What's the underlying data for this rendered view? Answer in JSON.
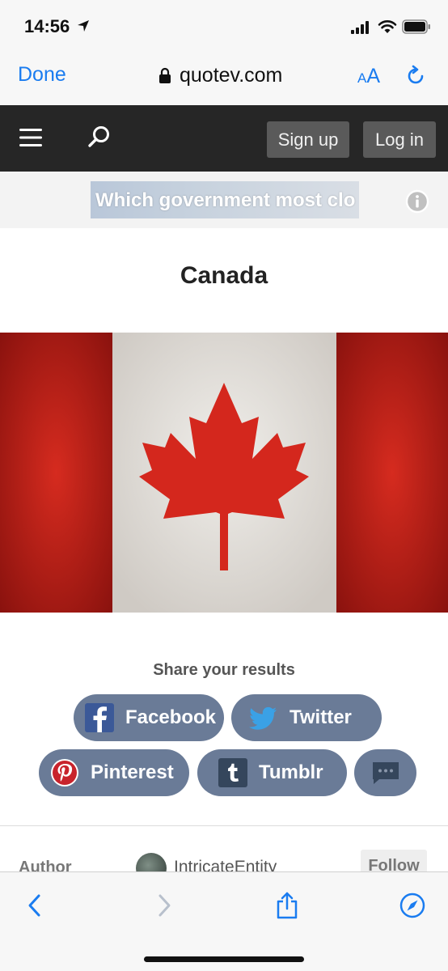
{
  "status_bar": {
    "time": "14:56",
    "icons": [
      "location-arrow-icon",
      "signal-icon",
      "wifi-icon",
      "battery-icon"
    ]
  },
  "safari": {
    "done_label": "Done",
    "url": "quotev.com",
    "aa_small": "A",
    "aa_big": "A",
    "icons": [
      "lock-icon",
      "reload-icon"
    ]
  },
  "site_nav": {
    "signup_label": "Sign up",
    "login_label": "Log in",
    "icons": [
      "menu-icon",
      "search-icon"
    ]
  },
  "quiz": {
    "title": "Which government most clo"
  },
  "result": {
    "title": "Canada",
    "flag_colors": {
      "red": "#c8221b",
      "white": "#e9e6e2"
    }
  },
  "share": {
    "heading": "Share your results",
    "facebook": "Facebook",
    "twitter": "Twitter",
    "pinterest": "Pinterest",
    "tumblr": "Tumblr",
    "button_color": "#6a7b97"
  },
  "author": {
    "label": "Author",
    "name": "IntricateEntity",
    "follow_label": "Follow"
  },
  "toolbar": {
    "icons": [
      "back-icon",
      "forward-icon",
      "share-icon",
      "compass-icon"
    ],
    "accent": "#1a7cf0"
  }
}
